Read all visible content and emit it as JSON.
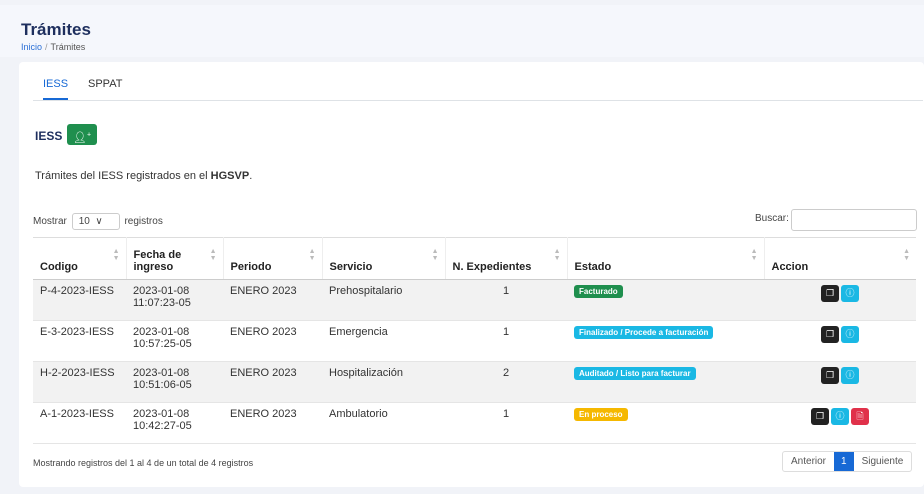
{
  "header": {
    "title": "Trámites",
    "breadcrumb": [
      "Inicio",
      "Trámites"
    ]
  },
  "tabs": [
    {
      "label": "IESS",
      "active": true
    },
    {
      "label": "SPPAT",
      "active": false
    }
  ],
  "section": {
    "label": "IESS",
    "add_icon": "user-plus-icon"
  },
  "description": {
    "prefix": "Trámites del IESS registrados en el ",
    "bold": "HGSVP",
    "suffix": "."
  },
  "table_controls": {
    "show_prefix": "Mostrar",
    "page_size": "10",
    "show_suffix": "registros",
    "search_label": "Buscar:",
    "search_value": ""
  },
  "columns": [
    "Codigo",
    "Fecha de ingreso",
    "Periodo",
    "Servicio",
    "N. Expedientes",
    "Estado",
    "Accion"
  ],
  "rows": [
    {
      "codigo": "P-4-2023-IESS",
      "fecha": "2023-01-08 11:07:23-05",
      "periodo": "ENERO 2023",
      "servicio": "Prehospitalario",
      "expedientes": "1",
      "estado": "Facturado",
      "estado_color": "#1f8f4e",
      "actions": [
        "copy-icon",
        "info-icon"
      ]
    },
    {
      "codigo": "E-3-2023-IESS",
      "fecha": "2023-01-08 10:57:25-05",
      "periodo": "ENERO 2023",
      "servicio": "Emergencia",
      "expedientes": "1",
      "estado": "Finalizado / Procede a facturación",
      "estado_color": "#1ab8e4",
      "actions": [
        "copy-icon",
        "info-icon"
      ]
    },
    {
      "codigo": "H-2-2023-IESS",
      "fecha": "2023-01-08 10:51:06-05",
      "periodo": "ENERO 2023",
      "servicio": "Hospitalización",
      "expedientes": "2",
      "estado": "Auditado / Listo para facturar",
      "estado_color": "#1ab8e4",
      "actions": [
        "copy-icon",
        "info-icon"
      ]
    },
    {
      "codigo": "A-1-2023-IESS",
      "fecha": "2023-01-08 10:42:27-05",
      "periodo": "ENERO 2023",
      "servicio": "Ambulatorio",
      "expedientes": "1",
      "estado": "En proceso",
      "estado_color": "#f5b800",
      "actions": [
        "copy-icon",
        "info-icon",
        "pdf-icon"
      ]
    }
  ],
  "footer": {
    "info": "Mostrando registros del 1 al 4 de un total de 4 registros",
    "prev": "Anterior",
    "current_page": "1",
    "next": "Siguiente"
  }
}
